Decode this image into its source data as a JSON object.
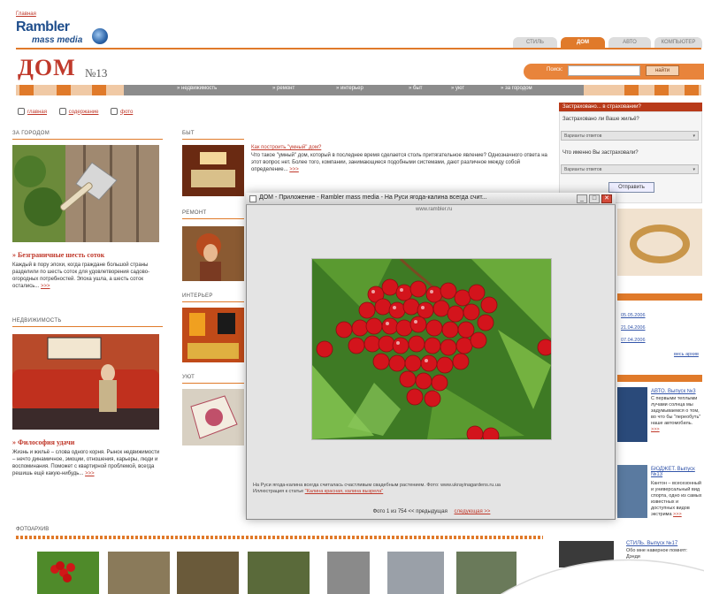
{
  "header": {
    "top_link": "Главная",
    "logo_rambler": "Rambler",
    "logo_media": "mass media",
    "tabs": [
      {
        "label": "СТИЛЬ"
      },
      {
        "label": "ДОМ"
      },
      {
        "label": "АВТО"
      },
      {
        "label": "КОМПЬЮТЕР"
      }
    ],
    "title": "ДОМ",
    "issue": "№13",
    "search_label": "Поиск:",
    "search_value": "",
    "search_button": "найти"
  },
  "nav": [
    "недвижимость",
    "ремонт",
    "интерьер",
    "быт",
    "уют",
    "за городом"
  ],
  "crumbs": [
    "главная",
    "содержание",
    "фото"
  ],
  "left": {
    "s1_head": "ЗА ГОРОДОМ",
    "s1_title": "» Безграничные шесть соток",
    "s1_text": "Каждый в пору эпохи, когда граждане большой страны разделили по шесть соток для удовлетворения садово-огородных потребностей. Эпоха ушла, а шесть соток остались...",
    "s2_head": "НЕДВИЖИМОСТЬ",
    "s2_title": "» Философия удачи",
    "s2_text": "Жизнь и жильё – слова одного корня. Рынок недвижимости – нечто динамичное, эмоции, отношения, карьеры, люди и воспоминания. Поможет с квартирной проблемой, всегда решишь ещё какую-нибудь...",
    "more": ">>>"
  },
  "mid": {
    "h_byt": "БЫТ",
    "h_remont": "РЕМОНТ",
    "h_interier": "ИНТЕРЬЕР",
    "h_uyut": "УЮТ",
    "art_title": "Как построить \"умный\" дом?",
    "art_text": "Что такое \"умный\" дом, который в последнее время сделается столь притягательное явление? Однозначного ответа на этот вопрос нет. Более того, компании, занимающиеся подобными системами, дают различное между собой определение...",
    "more": ">>>"
  },
  "poll": {
    "header": "Застраховано... в страховании?",
    "q1": "Застраховано ли Ваше жильё?",
    "sel1": "Варианты ответов",
    "q2": "Что именно Вы застраховали?",
    "sel2": "Варианты ответов",
    "button": "Отправить"
  },
  "modal": {
    "title": "ДОМ - Приложение - Rambler mass media - На Руси ягода-калина всегда счит...",
    "site": "www.rambler.ru",
    "caption": "На Руси ягода-калина всегда считалась счастливым свадебным растением. Фото: www.ukrayinagardens.ru.ua",
    "caption2": "Иллюстрация к статье",
    "caption_link": "\"Калина красная, калина вызрела\"",
    "pager": "Фото 1 из 754",
    "prev": "<< предыдущая",
    "next": "следующая >>",
    "buttons": [
      "_",
      "□",
      "✕"
    ]
  },
  "right": {
    "dates": [
      "05.05.2006",
      "21.04.2006",
      "07.04.2006"
    ],
    "all_link": "весь архив",
    "p1_title": "АВТО. Выпуск №3",
    "p1_text": "С первыми теплыми лучами солнца мы задумываемся о том, во что бы \"переобуть\" наше автомобиль.",
    "p2_title": "БЮДЖЕТ. Выпуск №13",
    "p2_text": "Кантон – всесезонный и универсальный вид спорта, одно из самых известных и доступных видов экстрима",
    "p3_title": "СТИЛЬ. Выпуск №17",
    "p3_text": "Обо мне наверное помнят: Дэнди",
    "more": ">>>"
  },
  "bottom": {
    "head": "ФОТОАРХИВ"
  },
  "colors": {
    "accent": "#e07a2a",
    "brand": "#c0392b",
    "nav": "#8c8c8c"
  }
}
